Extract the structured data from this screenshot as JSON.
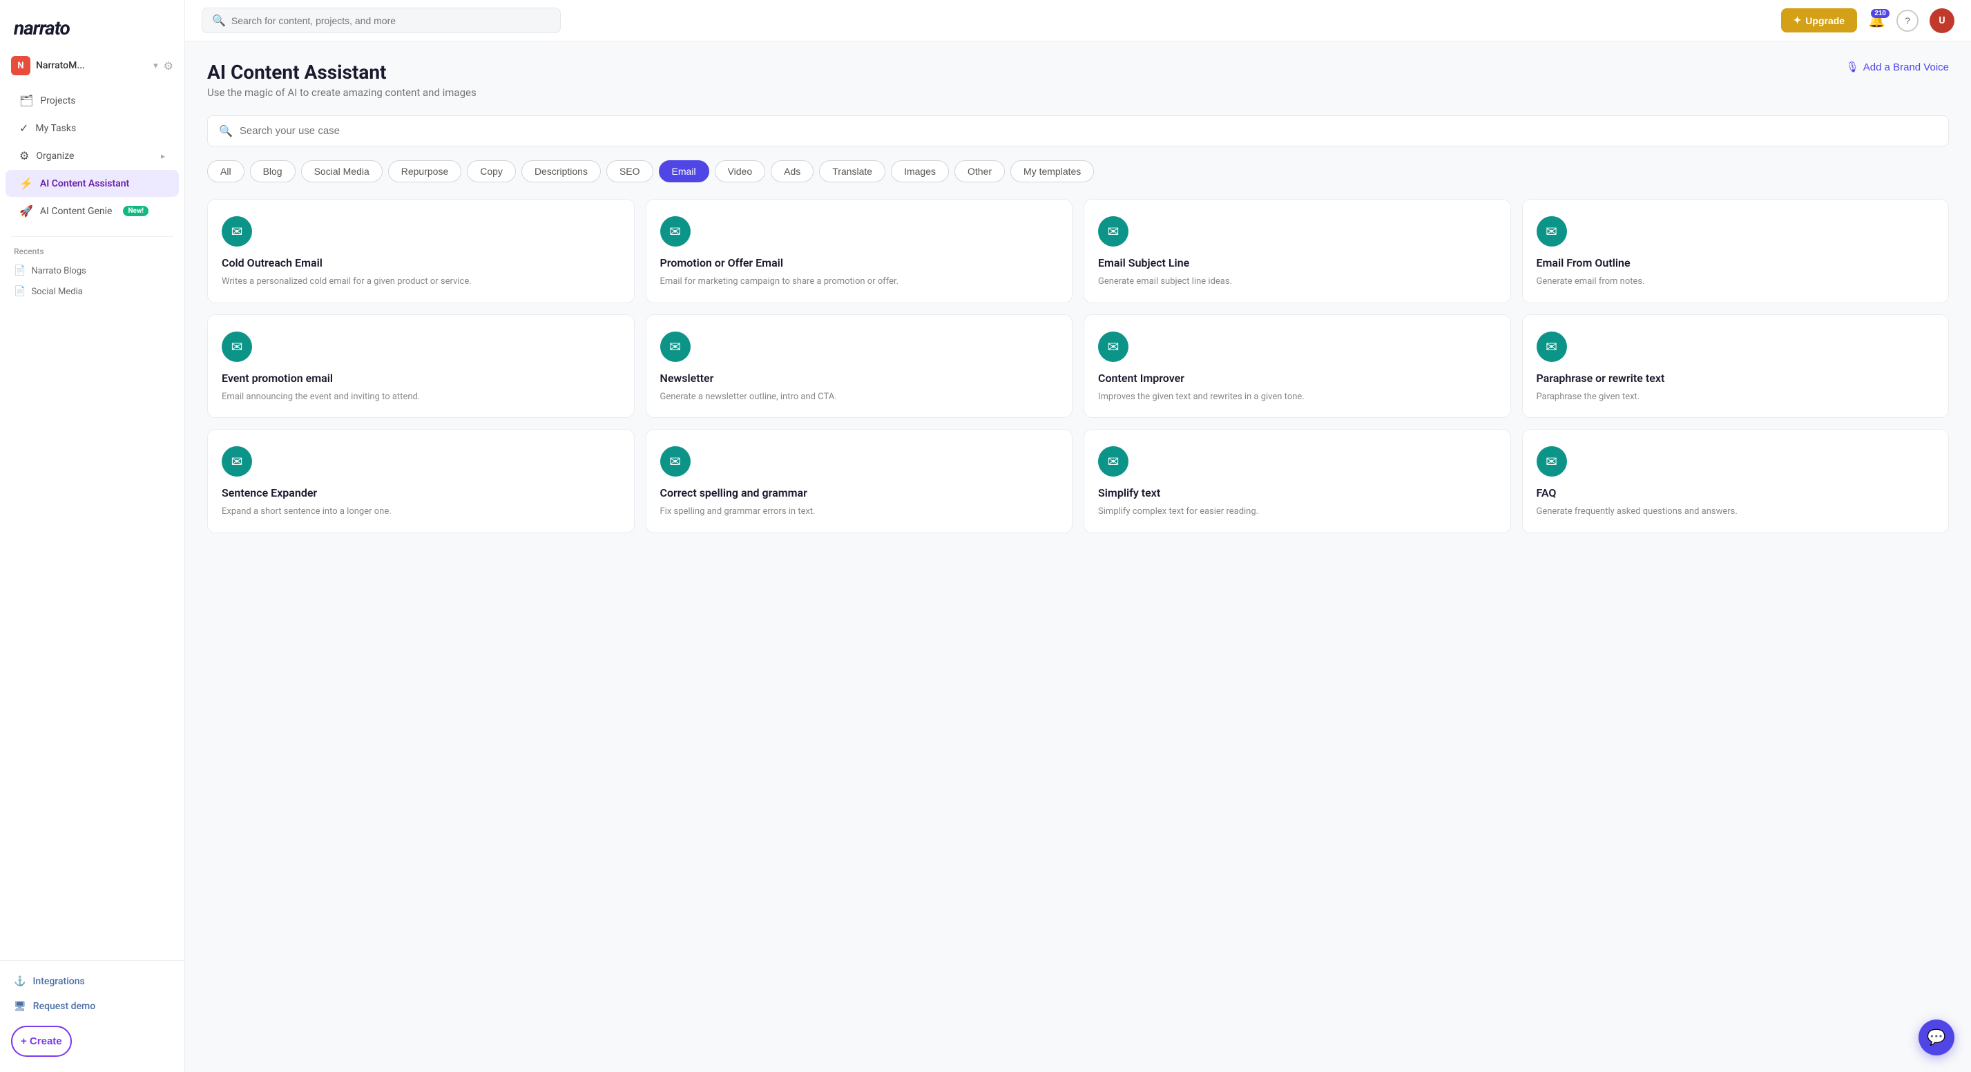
{
  "sidebar": {
    "logo": "narrato",
    "workspace": {
      "initial": "N",
      "name": "NarratoM..."
    },
    "nav_items": [
      {
        "id": "projects",
        "label": "Projects",
        "icon": "🗂"
      },
      {
        "id": "my-tasks",
        "label": "My Tasks",
        "icon": "✓"
      },
      {
        "id": "organize",
        "label": "Organize",
        "icon": "⚙",
        "has_arrow": true
      },
      {
        "id": "ai-content-assistant",
        "label": "AI Content Assistant",
        "icon": "⚡",
        "active": true
      },
      {
        "id": "ai-content-genie",
        "label": "AI Content Genie",
        "icon": "🚀",
        "badge": "New!"
      }
    ],
    "recents_label": "Recents",
    "recents": [
      {
        "label": "Narrato Blogs",
        "icon": "📄"
      },
      {
        "label": "Social Media",
        "icon": "📄"
      }
    ],
    "bottom_items": [
      {
        "id": "integrations",
        "label": "Integrations",
        "icon": "⚓"
      },
      {
        "id": "request-demo",
        "label": "Request demo",
        "icon": "🖥"
      }
    ],
    "create_label": "+ Create"
  },
  "topbar": {
    "search_placeholder": "Search for content, projects, and more",
    "upgrade_label": "Upgrade",
    "notif_count": "210",
    "help_label": "?"
  },
  "page": {
    "title": "AI Content Assistant",
    "subtitle": "Use the magic of AI to create amazing content and images",
    "brand_voice_label": "Add a Brand Voice",
    "use_case_placeholder": "Search your use case",
    "filter_tabs": [
      {
        "id": "all",
        "label": "All"
      },
      {
        "id": "blog",
        "label": "Blog"
      },
      {
        "id": "social-media",
        "label": "Social Media"
      },
      {
        "id": "repurpose",
        "label": "Repurpose"
      },
      {
        "id": "copy",
        "label": "Copy"
      },
      {
        "id": "descriptions",
        "label": "Descriptions"
      },
      {
        "id": "seo",
        "label": "SEO"
      },
      {
        "id": "email",
        "label": "Email",
        "active": true
      },
      {
        "id": "video",
        "label": "Video"
      },
      {
        "id": "ads",
        "label": "Ads"
      },
      {
        "id": "translate",
        "label": "Translate"
      },
      {
        "id": "images",
        "label": "Images"
      },
      {
        "id": "other",
        "label": "Other"
      },
      {
        "id": "my-templates",
        "label": "My templates"
      }
    ],
    "cards": [
      {
        "id": "cold-outreach-email",
        "title": "Cold Outreach Email",
        "desc": "Writes a personalized cold email for a given product or service.",
        "icon": "✉"
      },
      {
        "id": "promotion-or-offer-email",
        "title": "Promotion or Offer Email",
        "desc": "Email for marketing campaign to share a promotion or offer.",
        "icon": "✉"
      },
      {
        "id": "email-subject-line",
        "title": "Email Subject Line",
        "desc": "Generate email subject line ideas.",
        "icon": "✉"
      },
      {
        "id": "email-from-outline",
        "title": "Email From Outline",
        "desc": "Generate email from notes.",
        "icon": "✉"
      },
      {
        "id": "event-promotion-email",
        "title": "Event promotion email",
        "desc": "Email announcing the event and inviting to attend.",
        "icon": "✉"
      },
      {
        "id": "newsletter",
        "title": "Newsletter",
        "desc": "Generate a newsletter outline, intro and CTA.",
        "icon": "✉"
      },
      {
        "id": "content-improver",
        "title": "Content Improver",
        "desc": "Improves the given text and rewrites in a given tone.",
        "icon": "✉"
      },
      {
        "id": "paraphrase-or-rewrite-text",
        "title": "Paraphrase or rewrite text",
        "desc": "Paraphrase the given text.",
        "icon": "✉"
      },
      {
        "id": "sentence-expander",
        "title": "Sentence Expander",
        "desc": "Expand a short sentence into a longer one.",
        "icon": "✉"
      },
      {
        "id": "correct-spelling-and-grammar",
        "title": "Correct spelling and grammar",
        "desc": "Fix spelling and grammar errors in text.",
        "icon": "✉"
      },
      {
        "id": "simplify-text",
        "title": "Simplify text",
        "desc": "Simplify complex text for easier reading.",
        "icon": "✉"
      },
      {
        "id": "faq",
        "title": "FAQ",
        "desc": "Generate frequently asked questions and answers.",
        "icon": "✉"
      }
    ]
  }
}
